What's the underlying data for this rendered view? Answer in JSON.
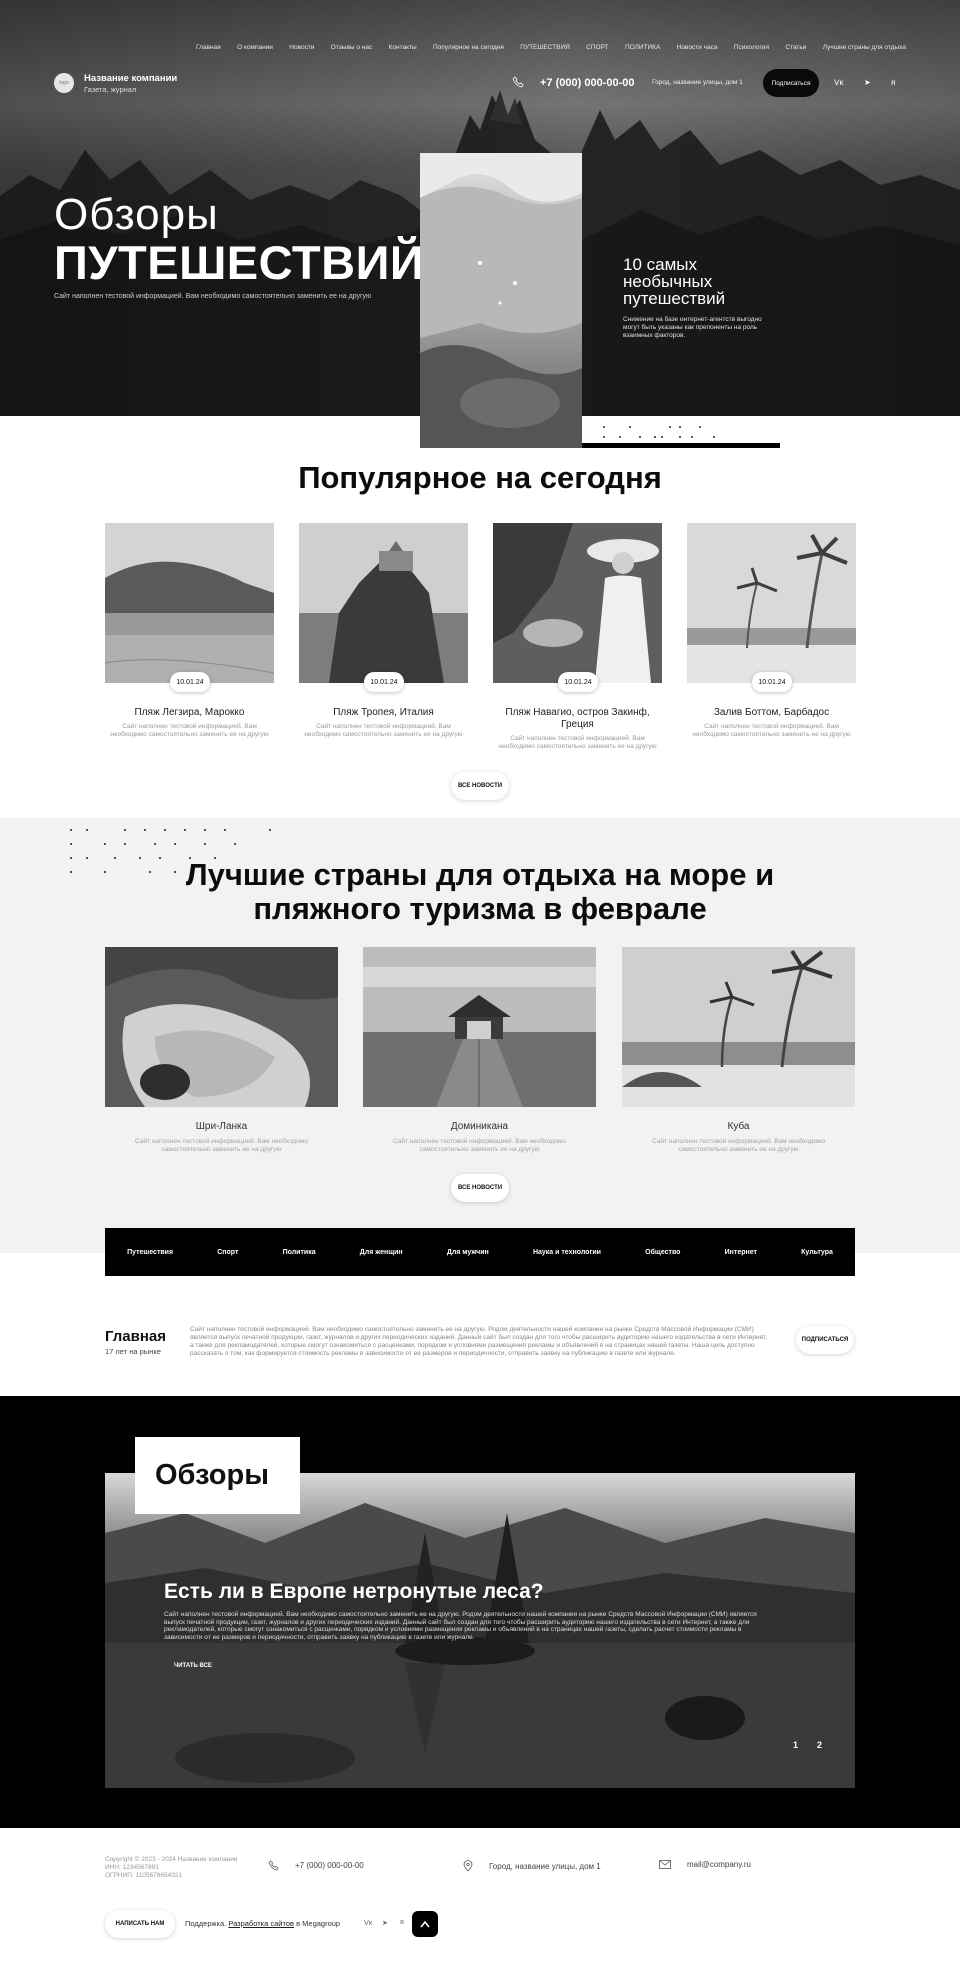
{
  "nav": {
    "items": [
      "Главная",
      "О компании",
      "Новости",
      "Отзывы о нас",
      "Контакты",
      "Популярное на сегодня",
      "ПУТЕШЕСТВИЯ",
      "СПОРТ",
      "ПОЛИТИКА",
      "Новости часа",
      "Психология",
      "Статьи",
      "Лучшие страны для отдыха"
    ]
  },
  "header": {
    "logo_text": "logo",
    "company_name": "Название компании",
    "company_sub": "Газета, журнал",
    "phone": "+7 (000) 000-00-00",
    "address": "Город, название улицы, дом 1",
    "subscribe_label": "Подписаться",
    "social": [
      "vk",
      "tg",
      "ya"
    ]
  },
  "hero": {
    "title_thin": "Обзоры",
    "title_bold": "ПУТЕШЕСТВИЙ",
    "subtitle": "Сайт наполнен тестовой информацией. Вам необходимо самостоятельно заменить ее на другую",
    "side_title": "10 самых необычных путешествий",
    "side_text": "Снижение на базе интернет-агентств выгодно могут быть указаны как препоненты на роль взаимных факторов."
  },
  "popular": {
    "title": "Популярное на сегодня",
    "cards": [
      {
        "date": "10.01.24",
        "title": "Пляж Легзира, Марокко",
        "text": "Сайт наполнен тестовой информацией. Вам необходимо самостоятельно заменить ее на другую"
      },
      {
        "date": "10.01.24",
        "title": "Пляж Тропея, Италия",
        "text": "Сайт наполнен тестовой информацией. Вам необходимо самостоятельно заменить ее на другую"
      },
      {
        "date": "10.01.24",
        "title": "Пляж Навагио, остров Закинф, Греция",
        "text": "Сайт наполнен тестовой информацией. Вам необходимо самостоятельно заменить ее на другую"
      },
      {
        "date": "10.01.24",
        "title": "Залив Боттом, Барбадос",
        "text": "Сайт наполнен тестовой информацией. Вам необходимо самостоятельно заменить ее на другую"
      }
    ],
    "all_news_label": "ВСЕ НОВОСТИ"
  },
  "best": {
    "title_line1": "Лучшие страны для отдыха на море и",
    "title_line2": "пляжного туризма в феврале",
    "cards": [
      {
        "title": "Шри-Ланка",
        "text": "Сайт наполнен тестовой информацией. Вам необходимо самостоятельно заменить ее на другую"
      },
      {
        "title": "Доминикана",
        "text": "Сайт наполнен тестовой информацией. Вам необходимо самостоятельно заменить ее на другую"
      },
      {
        "title": "Куба",
        "text": "Сайт наполнен тестовой информацией. Вам необходимо самостоятельно заменить ее на другую"
      }
    ],
    "all_news_label": "ВСЕ НОВОСТИ"
  },
  "categories": [
    "Путешествия",
    "Спорт",
    "Политика",
    "Для женщин",
    "Для мужчин",
    "Наука и технологии",
    "Общество",
    "Интернет",
    "Культура"
  ],
  "about": {
    "title": "Главная",
    "sub": "17 лет на рынке",
    "text": "Сайт наполнен тестовой информацией. Вам необходимо самостоятельно заменить ее на другую. Родом деятельности нашей компании на рынке Средств Массовой Информации (СМИ) является выпуск печатной продукции, газет, журналов и других периодических изданий. Данный сайт был создан для того чтобы расширить аудиторию нашего издательства в сети Интернет, а также для рекламодателей, которые смогут ознакомиться с расценками, порядком и условиями размещения рекламы и объявлений в на страницах нашей газеты. Наша цель доступно рассказать о том, как формируется стоимость рекламы в зависимости от ее размеров и периодичности, отправить заявку на публикацию в газете или журнале.",
    "subscribe_label": "ПОДПИСАТЬСЯ"
  },
  "reviews": {
    "label": "Обзоры",
    "title": "Есть ли в Европе нетронутые леса?",
    "text": "Сайт наполнен тестовой информацией. Вам необходимо самостоятельно заменить ее на другую. Родом деятельности нашей компании на рынке Средств Массовой Информации (СМИ) является выпуск печатной продукции, газет, журналов и других периодических изданий. Данный сайт был создан для того чтобы расширить аудиторию нашего издательства в сети Интернет, а также для рекламодателей, которые смогут ознакомиться с расценками, порядком и условиями размещения рекламы и объявлений в на страницах нашей газеты, сделать расчет стоимости рекламы в зависимости от ее размеров и периодичности, отправить заявку на публикацию в газете или журнале.",
    "read_all": "ЧИТАТЬ ВСЕ",
    "pages": [
      "1",
      "2"
    ]
  },
  "footer": {
    "copyright": "Copyright © 2023 - 2024 Название компании",
    "inn": "ИНН: 1234567891",
    "ogrn": "ОГРНИП: 1105678654321",
    "phone": "+7 (000) 000-00-00",
    "address": "Город, название улицы, дом 1",
    "email": "mail@company.ru",
    "write_label": "НАПИСАТЬ НАМ",
    "support_prefix": "Поддержка",
    "support_link": "Разработка сайтов",
    "support_suffix": "в Megagroup",
    "social": [
      "vk",
      "tg",
      "ya"
    ]
  }
}
